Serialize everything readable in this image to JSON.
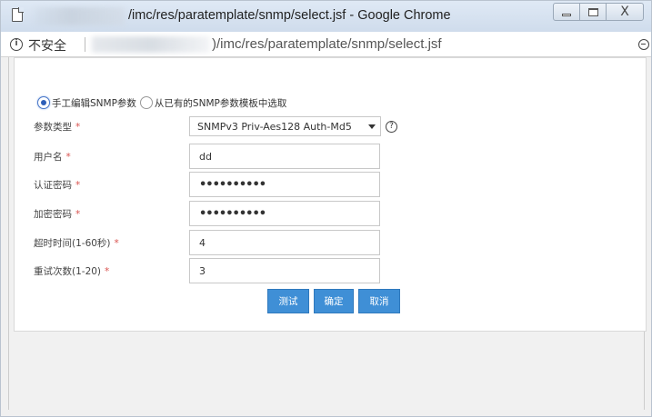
{
  "window": {
    "title": "/imc/res/paratemplate/snmp/select.jsf - Google Chrome",
    "close_glyph": "X"
  },
  "addressbar": {
    "security_label": "不安全",
    "info_glyph": "i",
    "url": ")/imc/res/paratemplate/snmp/select.jsf"
  },
  "form": {
    "radio_manual_label": "手工编辑SNMP参数",
    "radio_template_label": "从已有的SNMP参数模板中选取",
    "required_mark": "*",
    "param_type": {
      "label": "参数类型",
      "value": "SNMPv3 Priv-Aes128 Auth-Md5"
    },
    "username": {
      "label": "用户名",
      "value": "dd"
    },
    "auth_password": {
      "label": "认证密码",
      "value": "••••••••••"
    },
    "priv_password": {
      "label": "加密密码",
      "value": "••••••••••"
    },
    "timeout": {
      "label": "超时时间(1-60秒)",
      "value": "4"
    },
    "retries": {
      "label": "重试次数(1-20)",
      "value": "3"
    },
    "help_glyph": "?"
  },
  "buttons": {
    "test": "测试",
    "ok": "确定",
    "cancel": "取消"
  },
  "colors": {
    "button_bg": "#3f8fd6",
    "required": "#d9534f",
    "radio_selected": "#2e5fb8"
  }
}
